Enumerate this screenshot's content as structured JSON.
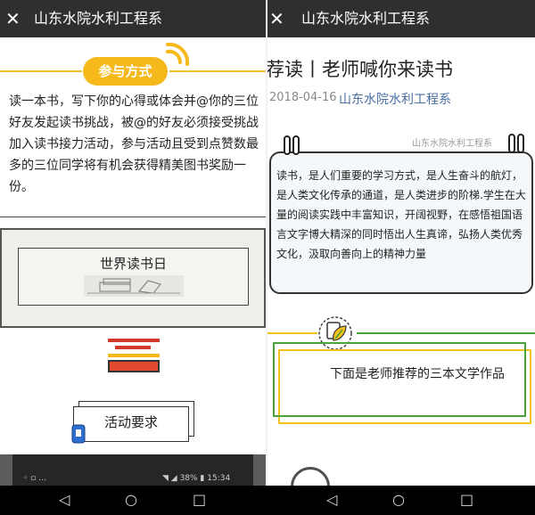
{
  "left_pane": {
    "header": {
      "close": "✕",
      "title": "山东水院水利工程系"
    },
    "section_badge": "参与方式",
    "paragraph": "读一本书，写下你的心得或体会并@你的三位好友发起读书挑战，被@的好友必须接受挑战加入读书接力活动，参与活动且受到点赞数最多的三位同学将有机会获得精美图书奖励一份。",
    "frame_title": "世界读书日",
    "requirements_label": "活动要求",
    "status_bar": {
      "left": "◦ ▫ …",
      "right": "◥ ◢ 38% ▮ 15:34"
    }
  },
  "right_pane": {
    "header": {
      "close": "✕",
      "title": "山东水院水利工程系"
    },
    "article_title": "荐读丨老师喊你来读书",
    "date": "2018-04-16",
    "author_link": "山东水院水利工程系",
    "watermark": "山东水院水利工程系",
    "quote": "读书，是人们重要的学习方式，是人生奋斗的航灯，是人类文化传承的通道，是人类进步的阶梯.学生在大量的阅读实践中丰富知识，开阔视野，在感悟祖国语言文字博大精深的同时悟出人生真谛，弘扬人类优秀文化，汲取向善向上的精神力量",
    "recommend_text": "下面是老师推荐的三本文学作品"
  },
  "nav": {
    "back": "◁",
    "home": "○",
    "recent": "□"
  },
  "colors": {
    "accent_yellow": "#f6b91c",
    "accent_green": "#4da13f",
    "link": "#4a6fa5",
    "header_bg": "#2f2f2f"
  }
}
